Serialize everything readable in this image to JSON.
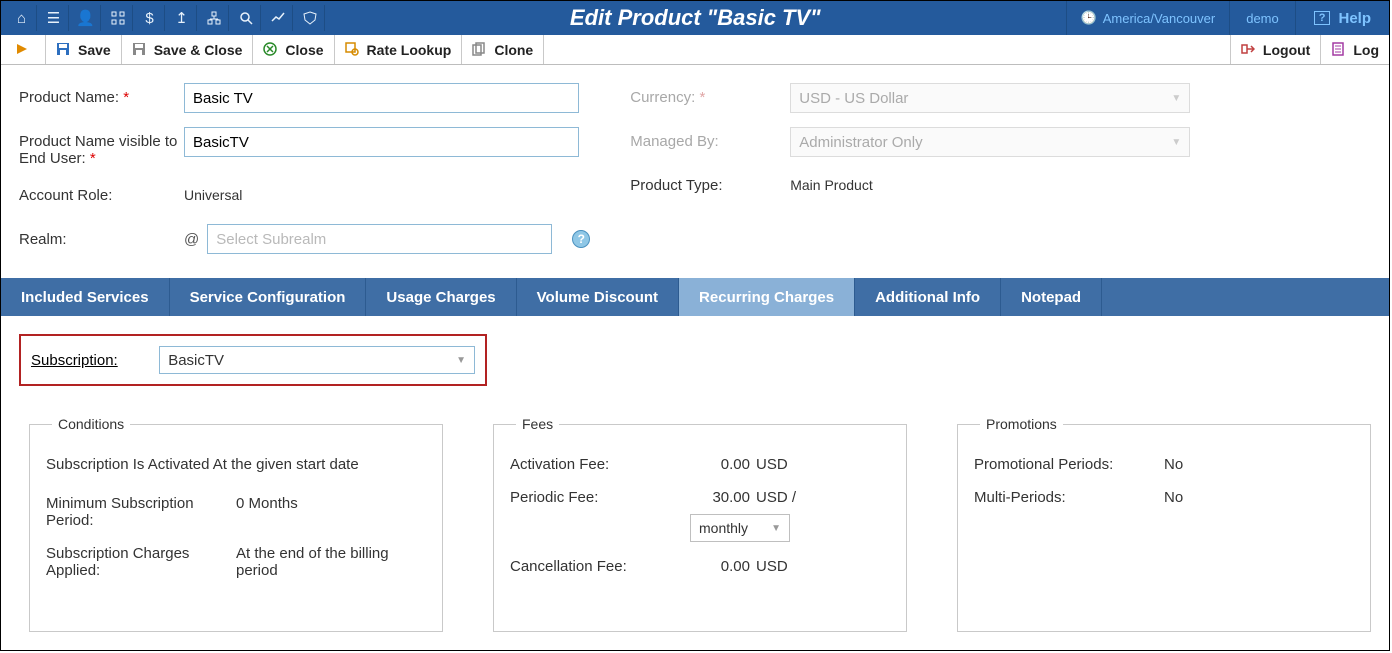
{
  "header": {
    "title": "Edit Product \"Basic TV\"",
    "timezone": "America/Vancouver",
    "user": "demo",
    "help": "Help"
  },
  "toolbar": {
    "save": "Save",
    "save_close": "Save & Close",
    "close": "Close",
    "rate_lookup": "Rate Lookup",
    "clone": "Clone",
    "logout": "Logout",
    "log": "Log"
  },
  "form": {
    "product_name_label": "Product Name:",
    "product_name_value": "Basic TV",
    "product_name_eu_label": "Product Name visible to End User:",
    "product_name_eu_value": "BasicTV",
    "account_role_label": "Account Role:",
    "account_role_value": "Universal",
    "realm_label": "Realm:",
    "realm_at": "@",
    "realm_placeholder": "Select Subrealm",
    "currency_label": "Currency:",
    "currency_value": "USD - US Dollar",
    "managed_by_label": "Managed By:",
    "managed_by_value": "Administrator Only",
    "product_type_label": "Product Type:",
    "product_type_value": "Main Product"
  },
  "tabs": {
    "t0": "Included Services",
    "t1": "Service Configuration",
    "t2": "Usage Charges",
    "t3": "Volume Discount",
    "t4": "Recurring Charges",
    "t5": "Additional Info",
    "t6": "Notepad"
  },
  "subscription": {
    "label": "Subscription:",
    "selected": "BasicTV"
  },
  "conditions": {
    "legend": "Conditions",
    "activation": "Subscription Is Activated At the given start date",
    "min_label": "Minimum Subscription Period:",
    "min_value": "0 Months",
    "charges_label": "Subscription Charges Applied:",
    "charges_value": "At the end of the billing period"
  },
  "fees": {
    "legend": "Fees",
    "activation_label": "Activation Fee:",
    "activation_value": "0.00",
    "currency": "USD",
    "periodic_label": "Periodic Fee:",
    "periodic_value": "30.00",
    "periodic_suffix": "/",
    "period_select": "monthly",
    "cancel_label": "Cancellation Fee:",
    "cancel_value": "0.00"
  },
  "promotions": {
    "legend": "Promotions",
    "pp_label": "Promotional Periods:",
    "pp_value": "No",
    "mp_label": "Multi-Periods:",
    "mp_value": "No"
  }
}
